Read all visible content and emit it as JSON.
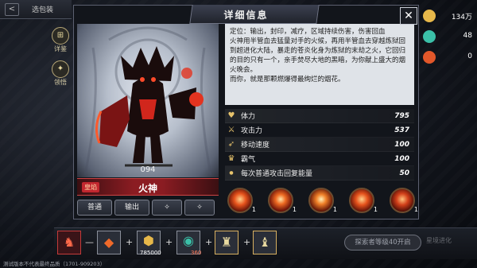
{
  "header": {
    "back_label": "<",
    "tab_label": "选包装"
  },
  "side_tabs": [
    {
      "icon": "detail-icon",
      "label": "详鉴"
    },
    {
      "icon": "lead-icon",
      "label": "领悟"
    }
  ],
  "dialog": {
    "title": "详细信息",
    "number": "094",
    "rank": "皇焰",
    "name": "火神",
    "buttons": [
      "普通",
      "输出"
    ],
    "description": "定位：输出，封印，减疗，区域持续伤害，伤害回血\n火神用半管血去猛量对手的火候，再用半管血去穿越炼狱回到超进化大陆，暴走的苍炎化身为炼狱的末劫之火，它回归的目的只有一个，亲手焚尽大地的黑暗，为你献上盛大的烟火晚会。\n而你，就是那颗燃爆得最绚烂的烟花。"
  },
  "stats": [
    {
      "icon": "heart-icon",
      "label": "体力",
      "value": "795"
    },
    {
      "icon": "sword-icon",
      "label": "攻击力",
      "value": "537"
    },
    {
      "icon": "boot-icon",
      "label": "移动速度",
      "value": "100"
    },
    {
      "icon": "crown-icon",
      "label": "霸气",
      "value": "100"
    },
    {
      "icon": "dot-icon",
      "label": "每次普通攻击回复能量",
      "value": "50"
    }
  ],
  "skills": [
    {
      "name": "skill-1",
      "level": "1"
    },
    {
      "name": "skill-2",
      "level": "1"
    },
    {
      "name": "skill-3",
      "level": "1"
    },
    {
      "name": "skill-4",
      "level": "1"
    },
    {
      "name": "skill-5",
      "level": "1"
    }
  ],
  "resources": [
    {
      "icon": "gold-icon",
      "value": "134万",
      "color": "#e7b84a"
    },
    {
      "icon": "gem-icon",
      "value": "48",
      "color": "#3bc0a8"
    },
    {
      "icon": "flame-icon",
      "value": "0",
      "color": "#e2572a"
    }
  ],
  "bottom": {
    "items": [
      {
        "name": "item-1",
        "count": ""
      },
      {
        "name": "item-2",
        "count": ""
      },
      {
        "name": "item-3",
        "count": "785000"
      },
      {
        "name": "item-4",
        "count": "360"
      },
      {
        "name": "item-5",
        "count": ""
      },
      {
        "name": "item-6",
        "count": ""
      }
    ],
    "explore_label": "探索者等级40开启",
    "faded_label": "星境进化"
  },
  "footnote": "测试版本不代表最终品质（1701-909203）"
}
